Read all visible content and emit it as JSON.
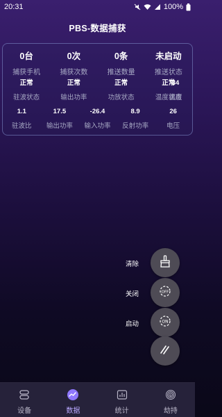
{
  "status_bar": {
    "time": "20:31",
    "battery": "100%"
  },
  "title": "PBS-数据捕获",
  "summary": [
    {
      "value": "0台",
      "label": "捕获手机"
    },
    {
      "value": "0次",
      "label": "捕获次数"
    },
    {
      "value": "0条",
      "label": "推送数量"
    },
    {
      "value": "未启动",
      "label": "推送状态"
    }
  ],
  "status_row": [
    {
      "value": "正常",
      "label": "驻波状态"
    },
    {
      "value": "正常",
      "label": "输出功率"
    },
    {
      "value": "正常",
      "label": "功放状态"
    },
    {
      "value": "正常",
      "label": "温度状态"
    }
  ],
  "temperature": {
    "value": "34",
    "label": "温度"
  },
  "metrics": [
    {
      "value": "1.1",
      "label": "驻波比"
    },
    {
      "value": "17.5",
      "label": "输出功率"
    },
    {
      "value": "-26.4",
      "label": "输入功率"
    },
    {
      "value": "8.9",
      "label": "反射功率"
    },
    {
      "value": "26",
      "label": "电压"
    }
  ],
  "actions": {
    "clear_label": "清除",
    "close_label": "关闭",
    "start_label": "启动"
  },
  "bottom_nav": [
    {
      "label": "设备",
      "icon": "device-icon"
    },
    {
      "label": "数据",
      "icon": "chart-icon",
      "active": true
    },
    {
      "label": "统计",
      "icon": "stats-icon"
    },
    {
      "label": "劫持",
      "icon": "fingerprint-icon"
    }
  ],
  "colors": {
    "accent": "#b9a8ff",
    "fab": "#4e4b55",
    "nav_bg": "#26223a"
  }
}
